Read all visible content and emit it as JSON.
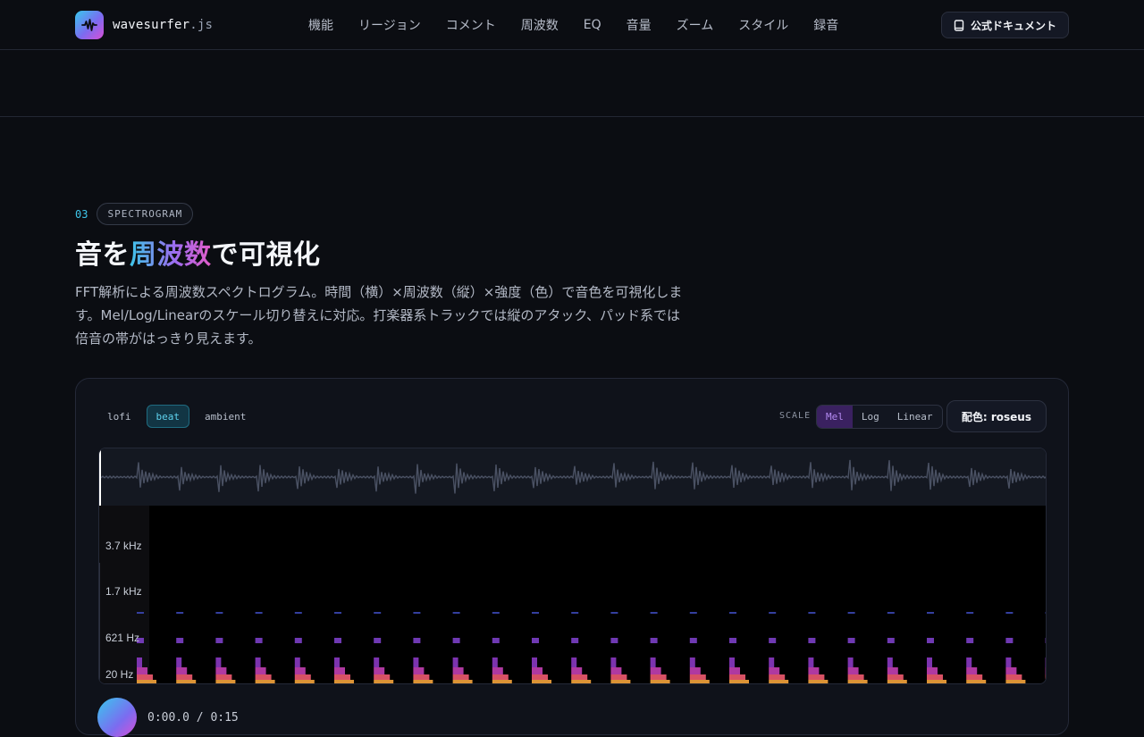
{
  "header": {
    "logo_name": "wavesurfer",
    "logo_ext": ".js",
    "nav": [
      "機能",
      "リージョン",
      "コメント",
      "周波数",
      "EQ",
      "音量",
      "ズーム",
      "スタイル",
      "録音"
    ],
    "docs_label": "公式ドキュメント"
  },
  "section": {
    "number": "03",
    "tag": "SPECTROGRAM",
    "title_pre": "音を",
    "title_highlight": "周波数",
    "title_post": "で可視化",
    "description": "FFT解析による周波数スペクトログラム。時間（横）×周波数（縦）×強度（色）で音色を可視化します。Mel/Log/Linearのスケール切り替えに対応。打楽器系トラックでは縦のアタック、パッド系では倍音の帯がはっきり見えます。"
  },
  "demo": {
    "tracks": [
      {
        "label": "lofi",
        "active": false
      },
      {
        "label": "beat",
        "active": true
      },
      {
        "label": "ambient",
        "active": false
      }
    ],
    "scale_label": "SCALE",
    "scale_options": [
      {
        "label": "Mel",
        "active": true
      },
      {
        "label": "Log",
        "active": false
      },
      {
        "label": "Linear",
        "active": false
      }
    ],
    "palette_label": "配色: roseus",
    "freq_labels": [
      "3.7 kHz",
      "1.7 kHz",
      "621  Hz",
      "20  Hz"
    ],
    "time_display": "0:00.0 / 0:15"
  },
  "colors": {
    "accent_cyan": "#3ec6ea",
    "accent_purple": "#9c6cf0",
    "accent_pink": "#e45cc8",
    "background": "#0b0d12"
  }
}
